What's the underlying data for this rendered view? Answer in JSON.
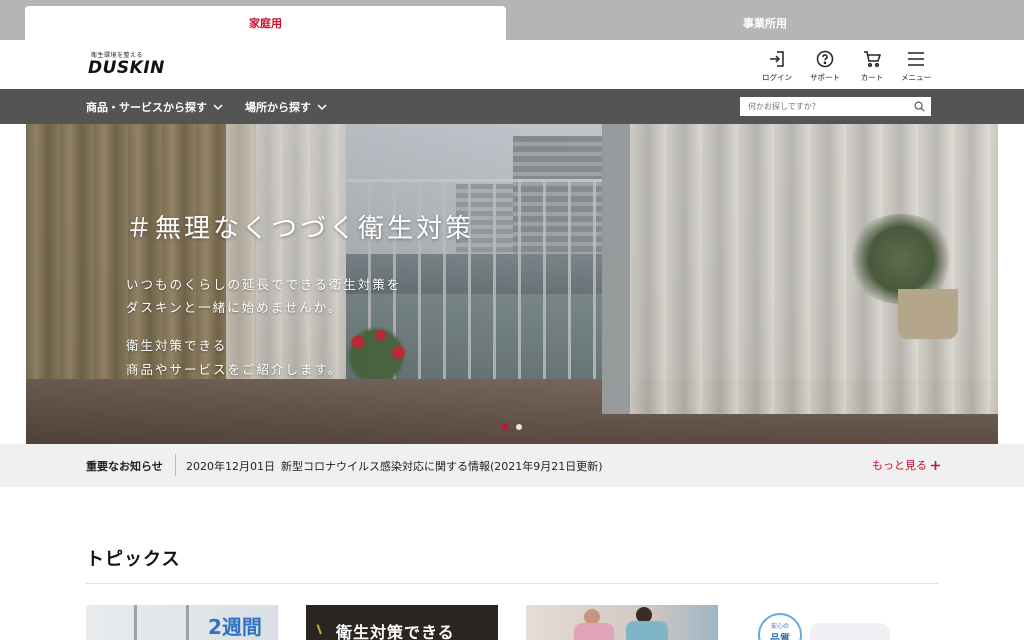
{
  "tabs": {
    "home": "家庭用",
    "business": "事業所用"
  },
  "header": {
    "logo_tagline": "衛生環境を整える",
    "logo_word": "DUSKIN",
    "icons": {
      "login": {
        "label": "ログイン",
        "icon": "login-icon"
      },
      "support": {
        "label": "サポート",
        "icon": "help-circle-icon"
      },
      "cart": {
        "label": "カート",
        "icon": "cart-icon"
      },
      "menu": {
        "label": "メニュー",
        "icon": "hamburger-menu-icon"
      }
    }
  },
  "nav": {
    "products": "商品・サービスから探す",
    "places": "場所から探す",
    "search_placeholder": "何かお探しですか？"
  },
  "hero": {
    "title": "＃無理なくつづく衛生対策",
    "lines": [
      "いつものくらしの延長でできる衛生対策を",
      "ダスキンと一緒に始めませんか。",
      "衛生対策できる",
      "商品やサービスをご紹介します。"
    ],
    "slides_total": 2,
    "slide_active": 1
  },
  "notice": {
    "label": "重要なお知らせ",
    "date": "2020年12月01日",
    "text": "新型コロナウイルス感染対応に関する情報(2021年9月21日更新)",
    "more": "もっと見る"
  },
  "topics": {
    "title": "トピックス",
    "cards": [
      {
        "caption": "2週間"
      },
      {
        "caption": "衛生対策できる"
      },
      {
        "caption": ""
      },
      {
        "badge_small": "安心の",
        "badge_large": "品質"
      }
    ]
  },
  "colors": {
    "accent": "#c8102e",
    "nav_bg": "#545454",
    "tab_bar_bg": "#b5b5b5",
    "notice_bg": "#f0f0f0"
  }
}
